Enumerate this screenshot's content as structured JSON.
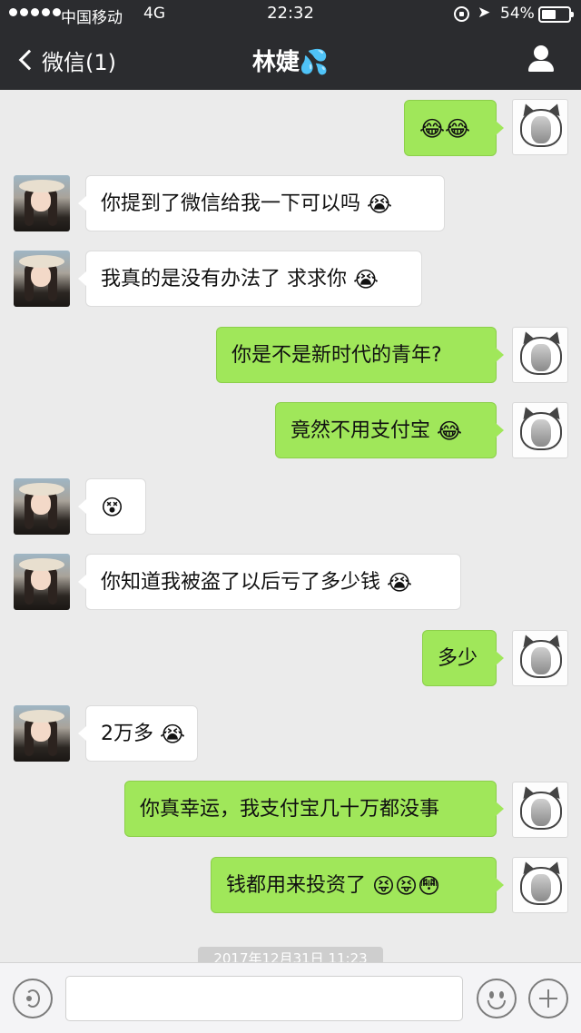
{
  "status_bar": {
    "carrier": "中国移动",
    "network": "4G",
    "time": "22:32",
    "battery": "54%",
    "battery_level": 0.54
  },
  "nav": {
    "back_label": "微信(1)",
    "title": "林婕💦"
  },
  "messages": [
    {
      "from": "me",
      "text": "",
      "emoji": "😂😂"
    },
    {
      "from": "her",
      "text": "你提到了微信给我一下可以吗",
      "emoji": "😭"
    },
    {
      "from": "her",
      "text": "我真的是没有办法了 求求你",
      "emoji": "😭"
    },
    {
      "from": "me",
      "text": "你是不是新时代的青年?",
      "emoji": ""
    },
    {
      "from": "me",
      "text": "竟然不用支付宝",
      "emoji": "😂"
    },
    {
      "from": "her",
      "text": "",
      "emoji": "😵"
    },
    {
      "from": "her",
      "text": "你知道我被盗了以后亏了多少钱",
      "emoji": "😭"
    },
    {
      "from": "me",
      "text": "多少",
      "emoji": ""
    },
    {
      "from": "her",
      "text": "2万多",
      "emoji": "😭"
    },
    {
      "from": "me",
      "text": "你真幸运，我支付宝几十万都没事",
      "emoji": ""
    },
    {
      "from": "me",
      "text": "钱都用来投资了",
      "emoji": "😝😝😳"
    }
  ],
  "timestamp": "2017年12月31日 11:23",
  "input": {
    "value": "",
    "placeholder": ""
  }
}
